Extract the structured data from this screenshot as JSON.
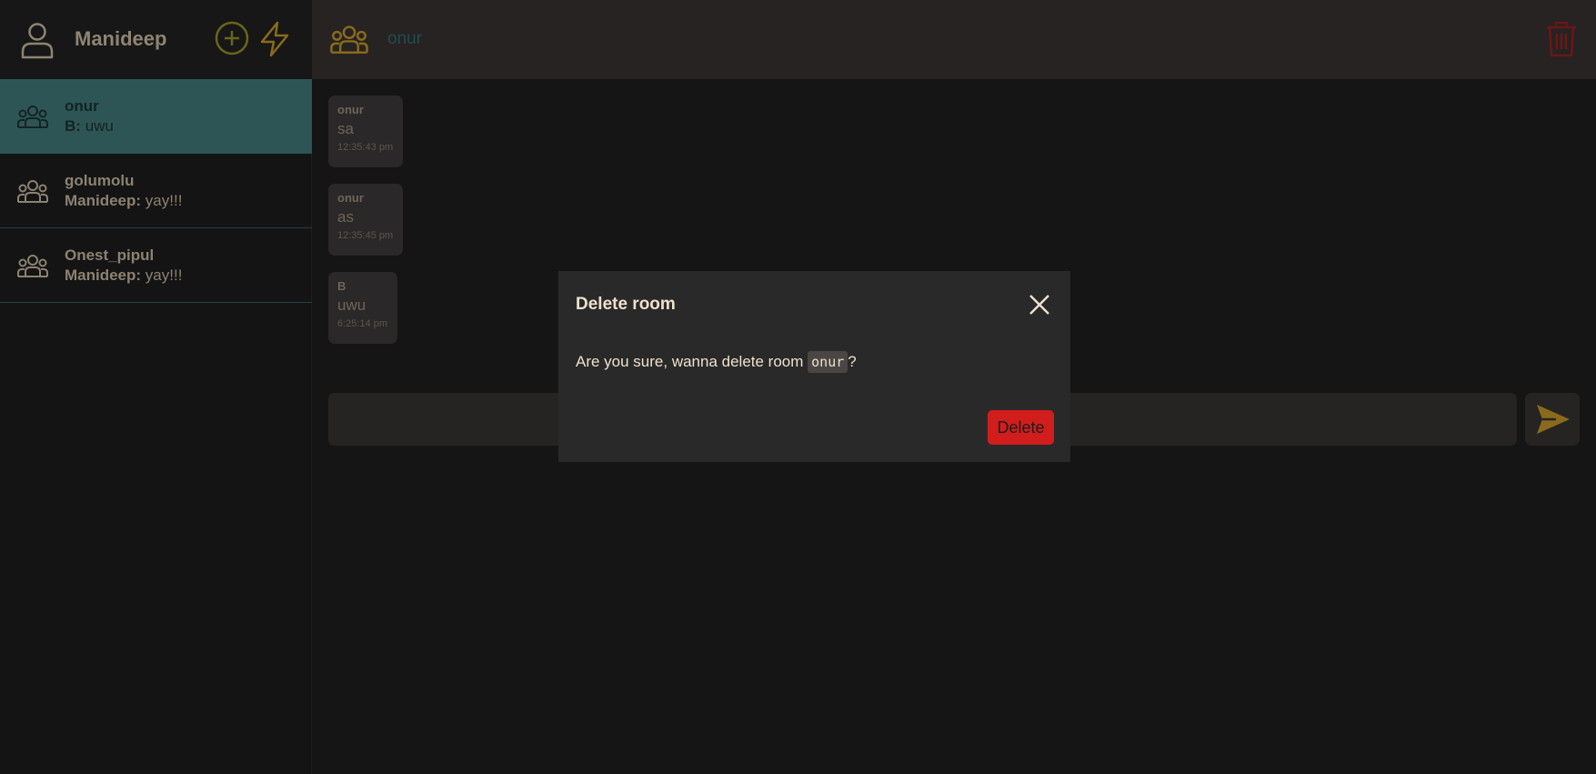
{
  "user": {
    "name": "Manideep"
  },
  "rooms": [
    {
      "name": "onur",
      "last_sender": "B:",
      "last_message": "uwu"
    },
    {
      "name": "golumolu",
      "last_sender": "Manideep:",
      "last_message": "yay!!!"
    },
    {
      "name": "Onest_pipul",
      "last_sender": "Manideep:",
      "last_message": "yay!!!"
    }
  ],
  "chat": {
    "room_name": "onur",
    "messages": [
      {
        "sender": "onur",
        "text": "sa",
        "time": "12:35:43 pm"
      },
      {
        "sender": "onur",
        "text": "as",
        "time": "12:35:45 pm"
      },
      {
        "sender": "B",
        "text": "uwu",
        "time": "6:25:14 pm"
      }
    ],
    "composer_placeholder": ""
  },
  "modal": {
    "title": "Delete room",
    "body_prefix": "Are you sure, wanna delete room",
    "room_code": "onur",
    "body_suffix": "?",
    "delete_label": "Delete"
  },
  "icons": {
    "user": "user-icon",
    "add": "plus-circle-icon",
    "bolt": "bolt-icon",
    "group": "group-icon",
    "trash": "trash-icon",
    "close": "close-icon",
    "send": "send-icon"
  },
  "colors": {
    "accent_teal": "#2d5556",
    "accent_gold": "#8a6a1c",
    "danger": "#d21d1d",
    "background": "#151515"
  }
}
